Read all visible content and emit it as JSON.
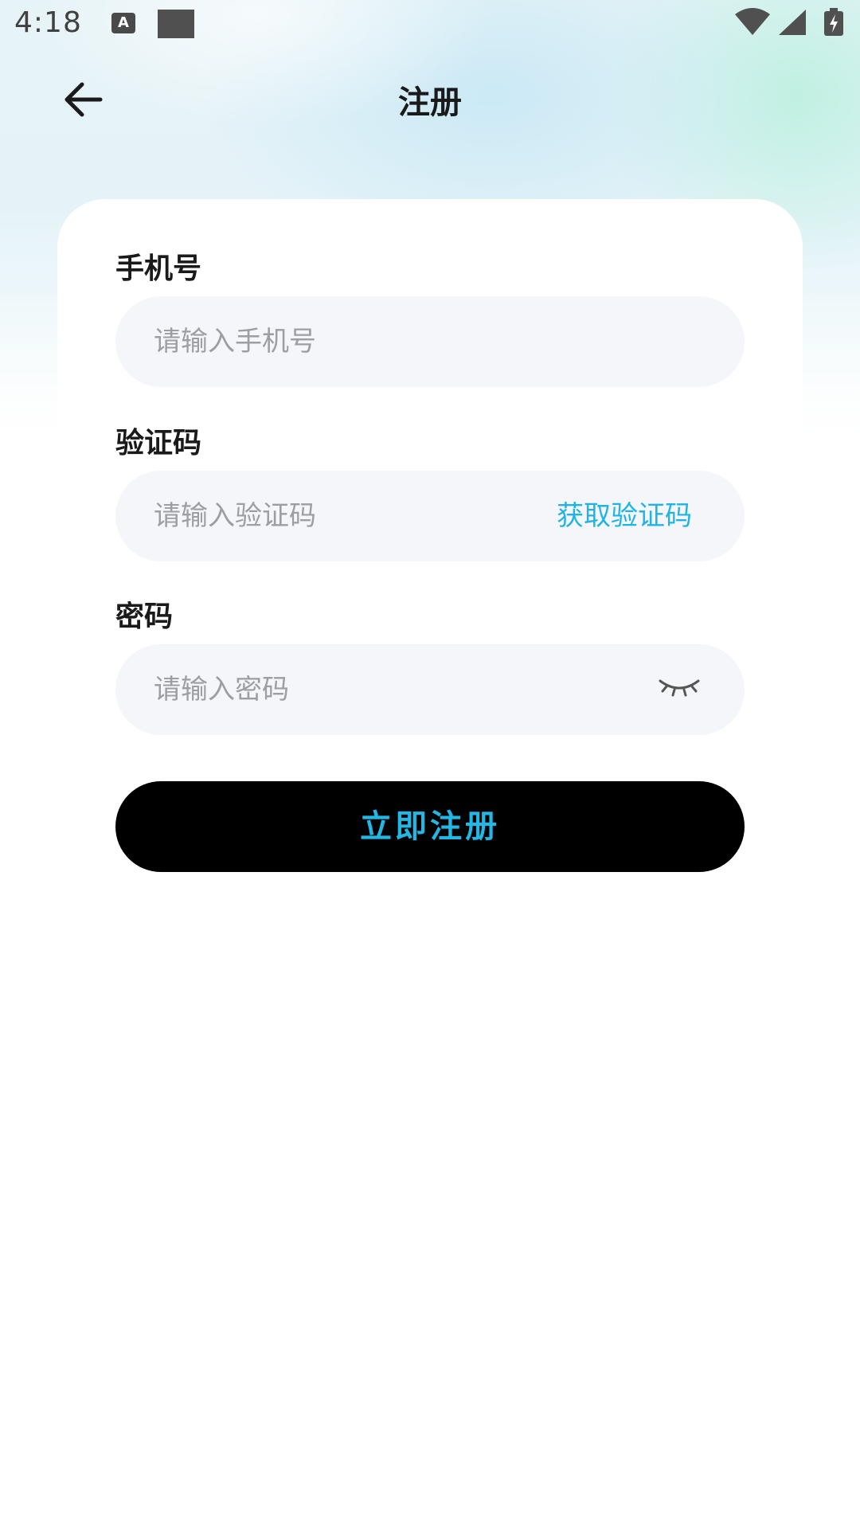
{
  "status_bar": {
    "time": "4:18",
    "a_badge": "A",
    "icons": [
      "a-notification-icon",
      "square-notification-icon",
      "wifi-icon",
      "signal-icon",
      "battery-charging-icon"
    ]
  },
  "header": {
    "back_icon": "arrow-left-icon",
    "title": "注册"
  },
  "form": {
    "phone": {
      "label": "手机号",
      "placeholder": "请输入手机号",
      "value": ""
    },
    "code": {
      "label": "验证码",
      "placeholder": "请输入验证码",
      "value": "",
      "get_code_label": "获取验证码"
    },
    "password": {
      "label": "密码",
      "placeholder": "请输入密码",
      "value": "",
      "toggle_icon": "eye-closed-icon"
    },
    "submit_label": "立即注册"
  },
  "colors": {
    "accent": "#1fb4e6",
    "button_bg": "#000000",
    "input_bg": "#f4f6fa",
    "text_primary": "#1a1a1a",
    "placeholder": "#9b9ea3"
  }
}
